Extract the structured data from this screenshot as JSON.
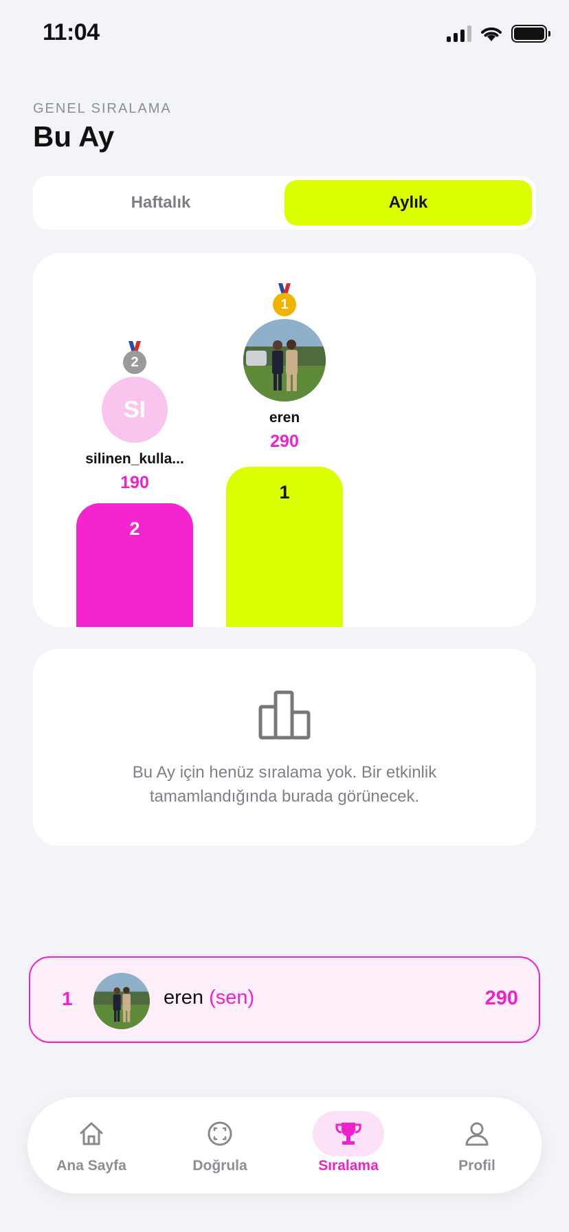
{
  "status_bar": {
    "time": "11:04"
  },
  "header": {
    "subtitle": "GENEL SIRALAMA",
    "title": "Bu Ay"
  },
  "segmented": {
    "weekly_label": "Haftalık",
    "monthly_label": "Aylık",
    "selected": "Aylık"
  },
  "podium": [
    {
      "rank": "2",
      "name": "silinen_kulla...",
      "score": "190",
      "initials": "SI",
      "block_color": "#f425cf",
      "medal_icon": "silver-medal-icon"
    },
    {
      "rank": "1",
      "name": "eren",
      "score": "290",
      "initials": "",
      "block_color": "#dcff00",
      "medal_icon": "gold-medal-icon"
    }
  ],
  "empty_state": {
    "icon": "bar-chart-icon",
    "text": "Bu Ay için henüz sıralama yok. Bir etkinlik tamamlandığında burada görünecek."
  },
  "my_row": {
    "rank": "1",
    "name": "eren",
    "you_label": "(sen)",
    "score": "290"
  },
  "bottom_nav": [
    {
      "label": "Ana Sayfa",
      "icon": "home-icon",
      "active": false
    },
    {
      "label": "Doğrula",
      "icon": "scan-face-icon",
      "active": false
    },
    {
      "label": "Sıralama",
      "icon": "trophy-icon",
      "active": true
    },
    {
      "label": "Profil",
      "icon": "user-icon",
      "active": false
    }
  ],
  "colors": {
    "accent_pink": "#ee22cc",
    "accent_lime": "#dcff00",
    "background": "#f3f4f8"
  }
}
